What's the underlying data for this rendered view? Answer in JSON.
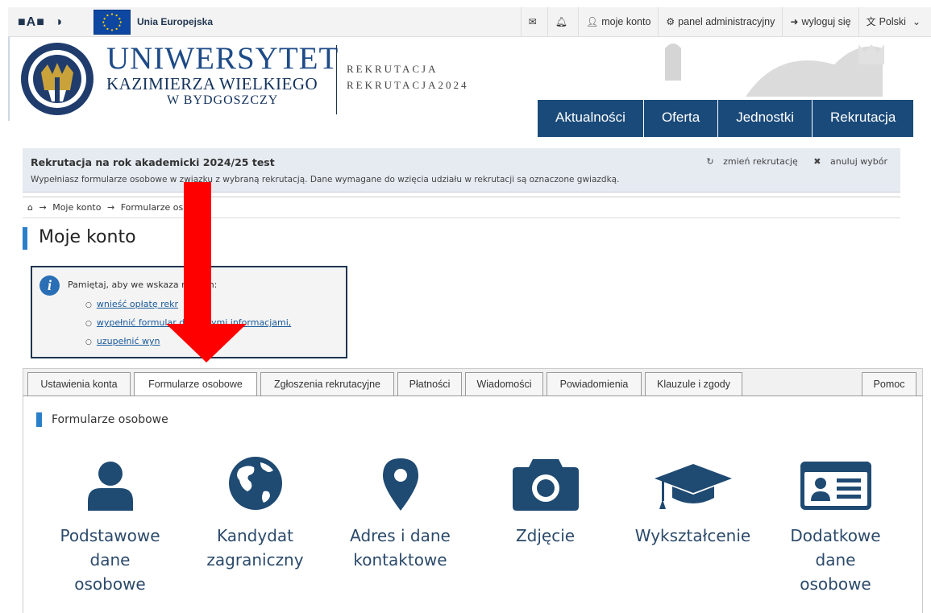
{
  "accessibility": {
    "text_small": "■A■",
    "contrast": "◑"
  },
  "eu": {
    "label": "Unia Europejska"
  },
  "toplinks": {
    "messages_icon": "envelope-icon",
    "notifications_icon": "bell-icon",
    "account": "moje konto",
    "admin": "panel administracyjny",
    "logout": "wyloguj się",
    "language": "Polski"
  },
  "header": {
    "uni_line1": "UNIWERSYTET",
    "uni_line2": "KAZIMIERZA WIELKIEGO",
    "uni_line3": "W BYDGOSZCZY",
    "rek_line1": "REKRUTACJA",
    "rek_line2": "REKRUTACJA2024"
  },
  "mainnav": [
    "Aktualności",
    "Oferta",
    "Jednostki",
    "Rekrutacja"
  ],
  "recruitment": {
    "title": "Rekrutacja na rok akademicki 2024/25 test",
    "description": "Wypełniasz formularze osobowe w związku z wybraną rekrutacją. Dane wymagane do wzięcia udziału w rekrutacji są oznaczone gwiazdką.",
    "change": "zmień rekrutację",
    "cancel": "anuluj wybór"
  },
  "breadcrumb": {
    "home_icon": "home-icon",
    "item1": "Moje konto",
    "item2": "Formularze os"
  },
  "page_title": "Moje konto",
  "notice": {
    "text": "Pamiętaj, aby we wskaza          minach:",
    "items": [
      "wnieść opłatę rekr",
      "wypełnić formular           datkowymi informacjami,",
      "uzupełnić wyn"
    ]
  },
  "tabs": [
    "Ustawienia konta",
    "Formularze osobowe",
    "Zgłoszenia rekrutacyjne",
    "Płatności",
    "Wiadomości",
    "Powiadomienia",
    "Klauzule i zgody",
    "Pomoc"
  ],
  "active_tab": "Formularze osobowe",
  "section_title": "Formularze osobowe",
  "tiles": [
    {
      "icon": "user-icon",
      "label_lines": [
        "Podstawowe",
        "dane",
        "osobowe"
      ]
    },
    {
      "icon": "globe-icon",
      "label_lines": [
        "Kandydat",
        "zagraniczny"
      ]
    },
    {
      "icon": "map-marker-icon",
      "label_lines": [
        "Adres i dane",
        "kontaktowe"
      ]
    },
    {
      "icon": "camera-icon",
      "label_lines": [
        "Zdjęcie"
      ]
    },
    {
      "icon": "graduation-cap-icon",
      "label_lines": [
        "Wykształcenie"
      ]
    },
    {
      "icon": "id-card-icon",
      "label_lines": [
        "Dodatkowe",
        "dane",
        "osobowe"
      ]
    }
  ],
  "colors": {
    "nav_bg": "#1a4a7a",
    "accent": "#2a7fc9",
    "icon": "#1f4a72",
    "annotation_arrow": "#ff0000"
  }
}
